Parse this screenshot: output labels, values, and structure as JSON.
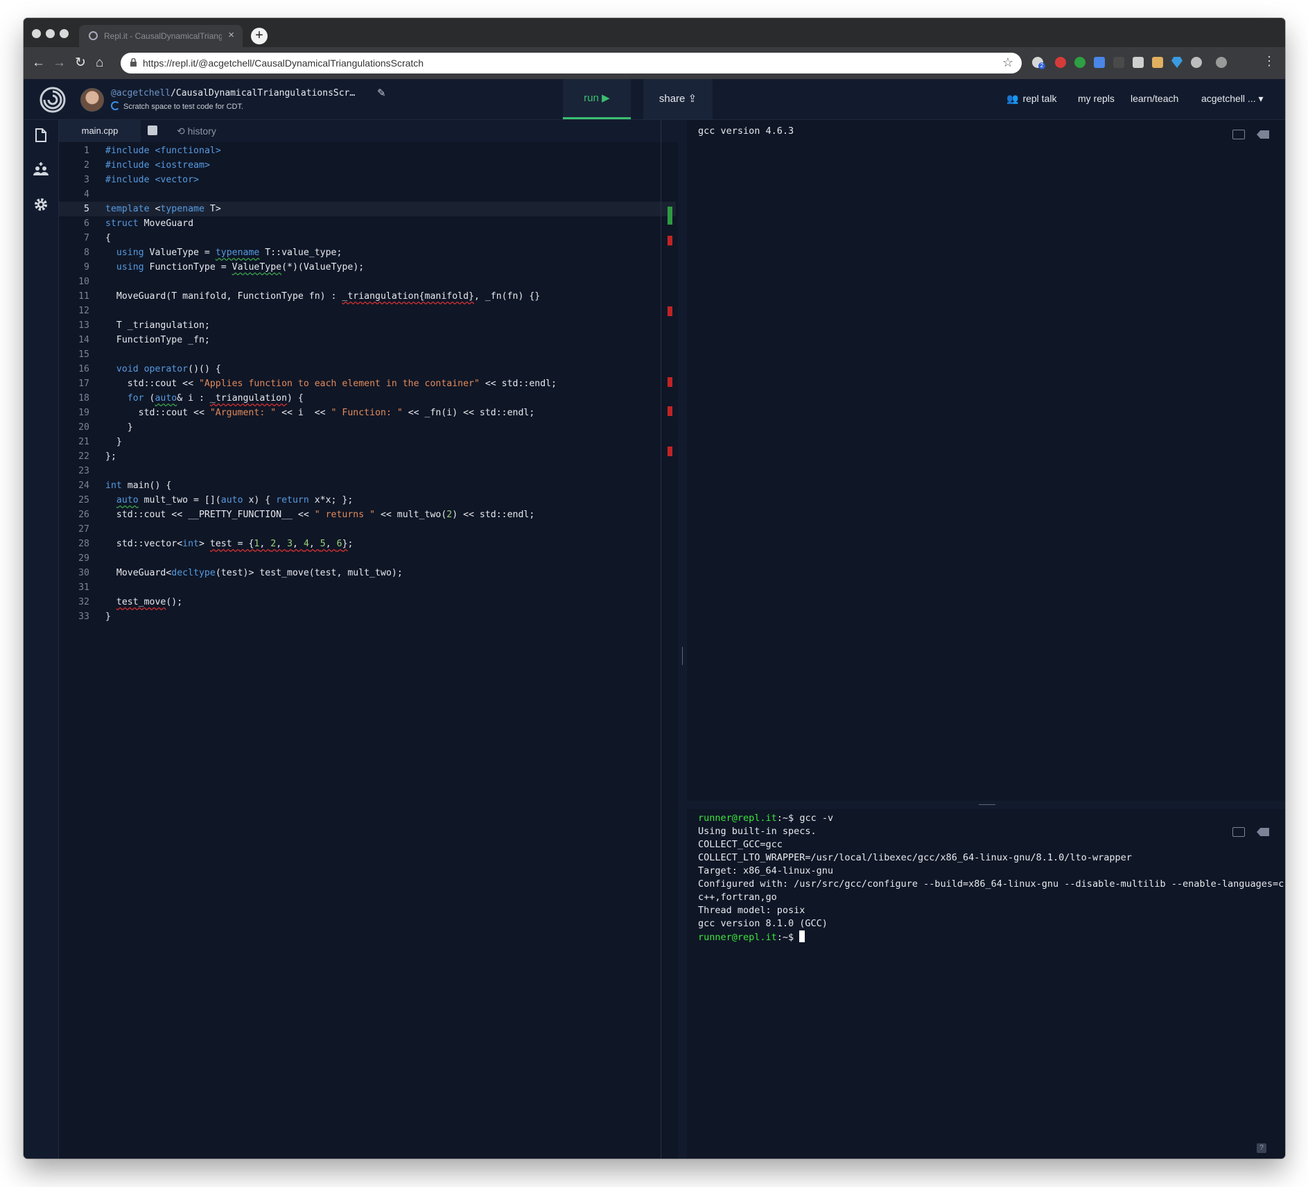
{
  "browser": {
    "tab_title": "Repl.it - CausalDynamicalTriangulationsScratch",
    "tab_close": "×",
    "new_tab": "+",
    "url": "https://repl.it/@acgetchell/CausalDynamicalTriangulationsScratch",
    "extension_badge": "2"
  },
  "header": {
    "owner": "@acgetchell",
    "repl_name": "/CausalDynamicalTriangulationsScr…",
    "description": "Scratch space to test code for CDT.",
    "run_label": "run ▶",
    "share_label": "share",
    "nav": {
      "repl_talk": "repl talk",
      "my_repls": "my repls",
      "learn_teach": "learn/teach",
      "user": "acgetchell ... ▾"
    }
  },
  "editor": {
    "tabs": {
      "file": "main.cpp",
      "history": "history"
    },
    "active_line": 5
  },
  "output_pane": {
    "lines": [
      "gcc version 4.6.3"
    ]
  },
  "terminal": {
    "prompt": "runner@repl.it",
    "prompt_suffix": ":~$ ",
    "command": "gcc -v",
    "lines": [
      "Using built-in specs.",
      "COLLECT_GCC=gcc",
      "COLLECT_LTO_WRAPPER=/usr/local/libexec/gcc/x86_64-linux-gnu/8.1.0/lto-wrapper",
      "Target: x86_64-linux-gnu",
      "Configured with: /usr/src/gcc/configure --build=x86_64-linux-gnu --disable-multilib --enable-languages=c,",
      "c++,fortran,go",
      "Thread model: posix",
      "gcc version 8.1.0 (GCC)"
    ]
  },
  "colors": {
    "accent_green": "#39c070",
    "prompt_green": "#39e63a",
    "background": "#0f1626",
    "keyword": "#569ae0",
    "string": "#e08a5a"
  },
  "icons": [
    "files-icon",
    "multiplayer-icon",
    "settings-icon",
    "history-icon",
    "share-icon",
    "repl-talk-icon",
    "star-icon",
    "lock-icon",
    "back-icon",
    "forward-icon",
    "reload-icon",
    "home-icon",
    "pencil-icon",
    "clear-icon",
    "open-icon",
    "help-icon"
  ]
}
